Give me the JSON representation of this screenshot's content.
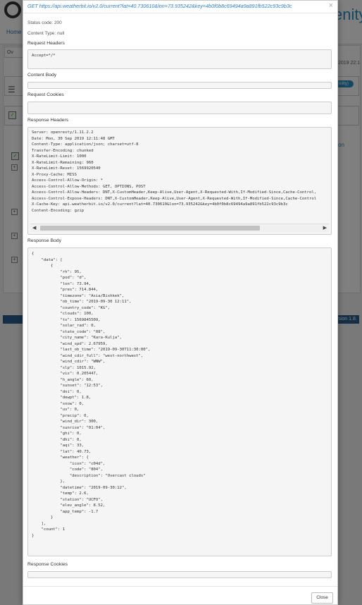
{
  "background": {
    "brand": "enity",
    "breadcrumb": "Home",
    "tab_label": "Ov",
    "date_fragment": "2019 22:1",
    "pill": "bility)",
    "column_fragment": "tion",
    "version": "rsion 1.8."
  },
  "modal": {
    "title": "GET https://api.weatherbit.io/v2.0/current?lat=40.730610&lon=73.935242&key=4b0f0b8c69494a9a891fb522c93c9b3c",
    "close_icon": "×",
    "status_code": "Status code: 200",
    "content_type": "Content Type: null",
    "request_headers_label": "Request Headers",
    "request_headers_value": "Accept=*/*",
    "content_body_label": "Content Body",
    "request_cookies_label": "Request Cookies",
    "response_headers_label": "Response Headers",
    "response_headers_lines": [
      "Server: openresty/1.11.2.2",
      "Date: Mon, 30 Sep 2019 12:11:48 GMT",
      "Content-Type: application/json; charset=utf-8",
      "Transfer-Encoding: chunked",
      "X-RateLimit-Limit: 1000",
      "X-RateLimit-Remaining: 960",
      "X-RateLimit-Reset: 1569920540",
      "X-Proxy-Cache: MISS",
      "Access-Control-Allow-Origin: *",
      "Access-Control-Allow-Methods: GET, OPTIONS, POST",
      "Access-Control-Allow-Headers: DNT,X-CustomHeader,Keep-Alive,User-Agent,X-Requested-With,If-Modified-Since,Cache-Control,",
      "Access-Control-Expose-Headers: DNT,X-CustomHeader,Keep-Alive,User-Agent,X-Requested-With,If-Modified-Since,Cache-Control",
      "X-Cache-Key: api.weatherbit.io/v2.0/current?lat=40.730610&lon=73.935242&key=4b0f0b8c69494a9a891fb522c93c9b3c",
      "Content-Encoding: gzip"
    ],
    "scroll_left_icon": "◀",
    "scroll_right_icon": "▶",
    "response_body_label": "Response Body",
    "response_body_lines": [
      "{",
      "    \"data\": [",
      "        {",
      "            \"rh\": 95,",
      "            \"pod\": \"d\",",
      "            \"lon\": 73.94,",
      "            \"pres\": 714.844,",
      "            \"timezone\": \"Asia/Bishkek\",",
      "            \"ob_time\": \"2019-09-30 12:11\",",
      "            \"country_code\": \"KG\",",
      "            \"clouds\": 100,",
      "            \"ts\": 1569845509,",
      "            \"solar_rad\": 0,",
      "            \"state_code\": \"08\",",
      "            \"city_name\": \"Kara-Kulja\",",
      "            \"wind_spd\": 2.67959,",
      "            \"last_ob_time\": \"2019-09-30T11:30:00\",",
      "            \"wind_cdir_full\": \"west-northwest\",",
      "            \"wind_cdir\": \"WNW\",",
      "            \"slp\": 1015.92,",
      "            \"vis\": 0.205447,",
      "            \"h_angle\": 60,",
      "            \"sunset\": \"12:53\",",
      "            \"dni\": 0,",
      "            \"dewpt\": 1.8,",
      "            \"snow\": 0,",
      "            \"uv\": 0,",
      "            \"precip\": 0,",
      "            \"wind_dir\": 300,",
      "            \"sunrise\": \"01:04\",",
      "            \"ghi\": 0,",
      "            \"dhi\": 0,",
      "            \"aqi\": 33,",
      "            \"lat\": 40.73,",
      "            \"weather\": {",
      "                \"icon\": \"c04d\",",
      "                \"code\": \"804\",",
      "                \"description\": \"Overcast clouds\"",
      "            },",
      "            \"datetime\": \"2019-09-30:12\",",
      "            \"temp\": 2.6,",
      "            \"station\": \"UCFO\",",
      "            \"elev_angle\": 8.52,",
      "            \"app_temp\": -1.7",
      "        }",
      "    ],",
      "    \"count\": 1",
      "}"
    ],
    "response_cookies_label": "Response Cookies",
    "close_button": "Close"
  }
}
